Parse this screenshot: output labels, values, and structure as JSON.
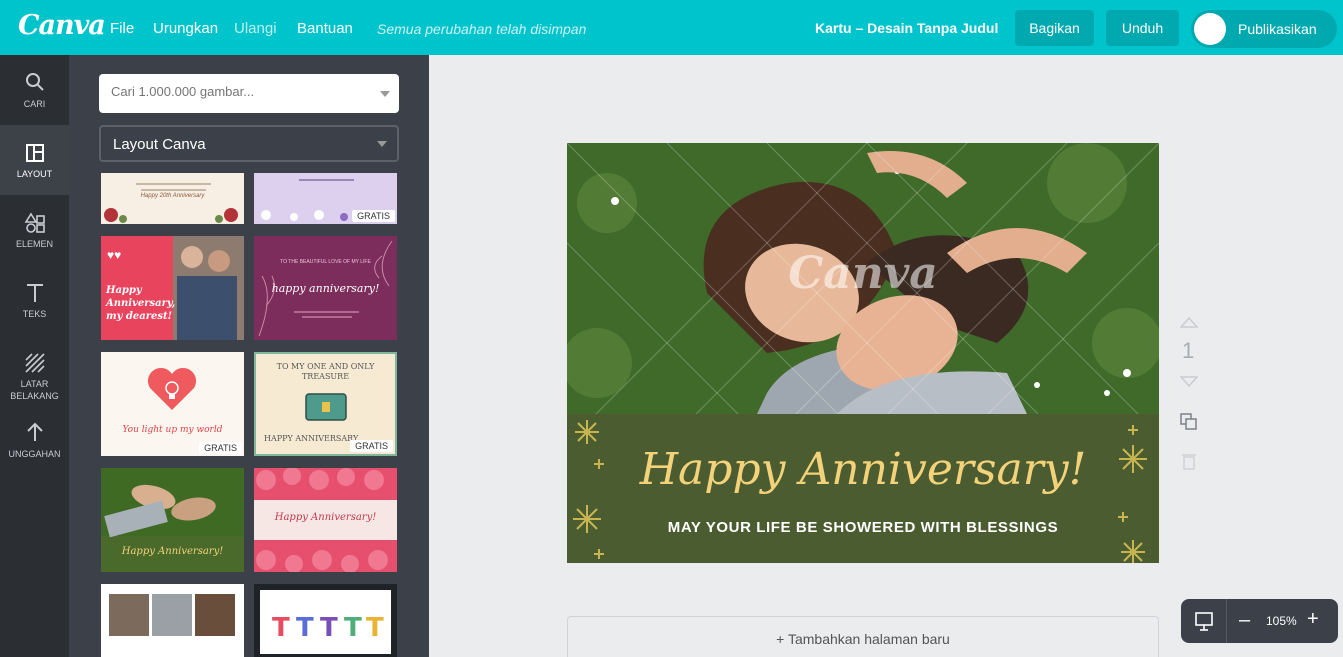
{
  "app": {
    "logo": "Canva",
    "brand_color": "#00c4cc"
  },
  "menu": {
    "file": "File",
    "undo": "Urungkan",
    "redo": "Ulangi",
    "help": "Bantuan",
    "saved_status": "Semua perubahan telah disimpan"
  },
  "header": {
    "doc_title": "Kartu – Desain Tanpa Judul",
    "share": "Bagikan",
    "download": "Unduh",
    "publish": "Publikasikan"
  },
  "rail": {
    "search": "CARI",
    "layout": "LAYOUT",
    "elements": "ELEMEN",
    "text": "TEKS",
    "background_1": "LATAR",
    "background_2": "BELAKANG",
    "uploads": "UNGGAHAN"
  },
  "panel": {
    "search_placeholder": "Cari 1.000.000 gambar...",
    "layout_select": "Layout Canva",
    "free_badge": "GRATIS",
    "thumbs": [
      {
        "text": "Happy 20th Anniversary"
      },
      {
        "text": ""
      },
      {
        "text": "Happy Anniversary, my dearest!"
      },
      {
        "text": "happy anniversary!",
        "sub": "TO THE BEAUTIFUL LOVE OF MY LIFE"
      },
      {
        "text": "You light up my world"
      },
      {
        "text": "TO MY ONE AND ONLY TREASURE",
        "sub": "HAPPY ANNIVERSARY"
      },
      {
        "text": "Happy Anniversary!"
      },
      {
        "text": "Happy Anniversary!"
      }
    ]
  },
  "canvas": {
    "watermark": "Canva",
    "headline": "Happy Anniversary!",
    "subline": "MAY YOUR LIFE BE SHOWERED WITH BLESSINGS",
    "page_number": "1"
  },
  "footer": {
    "add_page": "+ Tambahkan halaman baru",
    "zoom": "105%",
    "zoom_out": "–",
    "zoom_in": "+"
  }
}
